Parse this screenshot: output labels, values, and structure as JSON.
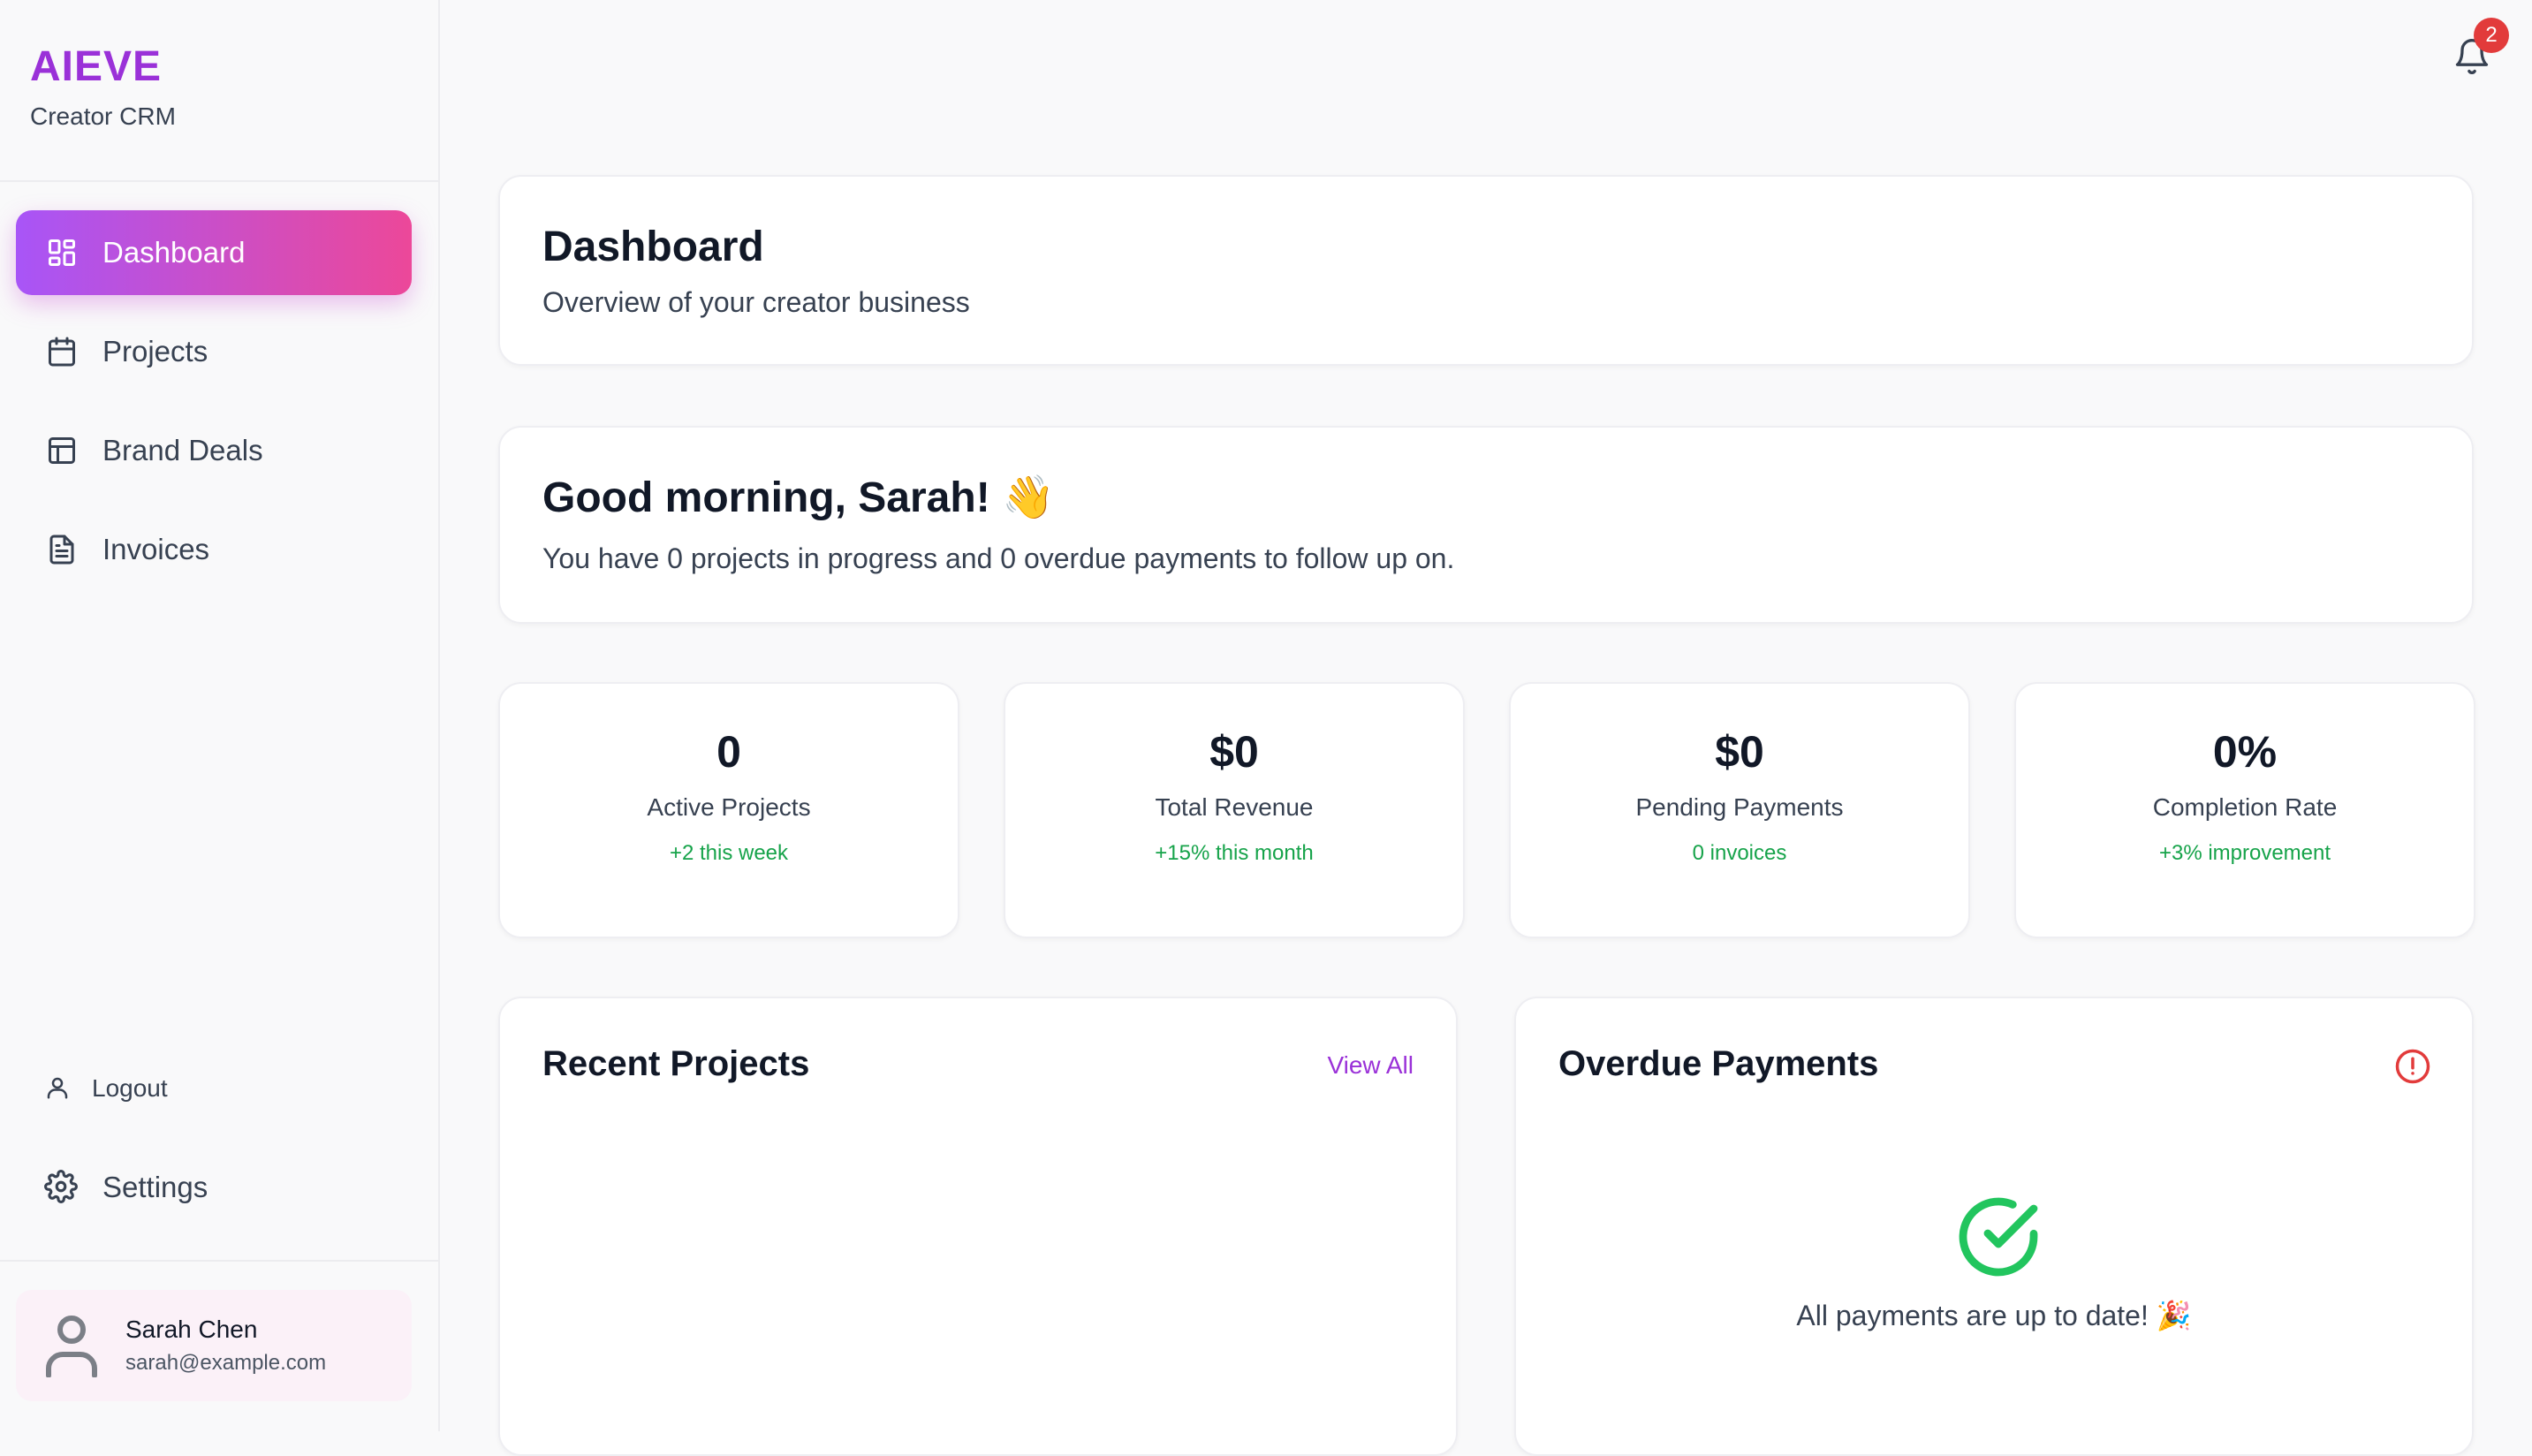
{
  "app": {
    "name": "AIEVE",
    "subtitle": "Creator CRM",
    "accent": "#9a31d8"
  },
  "sidebar": {
    "items": [
      {
        "label": "Dashboard",
        "icon": "dashboard-grid-icon",
        "active": true
      },
      {
        "label": "Projects",
        "icon": "calendar-icon",
        "active": false
      },
      {
        "label": "Brand Deals",
        "icon": "layout-icon",
        "active": false
      },
      {
        "label": "Invoices",
        "icon": "document-icon",
        "active": false
      }
    ],
    "logout_label": "Logout",
    "settings_label": "Settings",
    "user": {
      "name": "Sarah Chen",
      "email": "sarah@example.com"
    }
  },
  "header": {
    "notification_count": "2",
    "notification_icon": "bell-icon"
  },
  "page": {
    "title": "Dashboard",
    "subtitle": "Overview of your creator business"
  },
  "greeting": {
    "title": "Good morning, Sarah! 👋",
    "text": "You have 0 projects in progress and 0 overdue payments to follow up on."
  },
  "stats": [
    {
      "value": "0",
      "label": "Active Projects",
      "change": "+2 this week"
    },
    {
      "value": "$0",
      "label": "Total Revenue",
      "change": "+15% this month"
    },
    {
      "value": "$0",
      "label": "Pending Payments",
      "change": "0 invoices"
    },
    {
      "value": "0%",
      "label": "Completion Rate",
      "change": "+3% improvement"
    }
  ],
  "recent_projects": {
    "title": "Recent Projects",
    "view_all": "View All"
  },
  "overdue_payments": {
    "title": "Overdue Payments",
    "empty_message": "All payments are up to date! 🎉",
    "alert_icon": "alert-circle-icon",
    "check_icon": "check-circle-icon"
  },
  "colors": {
    "gradient_start": "#a855f7",
    "gradient_end": "#ec4899",
    "positive": "#16a34a",
    "badge": "#e23b3b"
  }
}
